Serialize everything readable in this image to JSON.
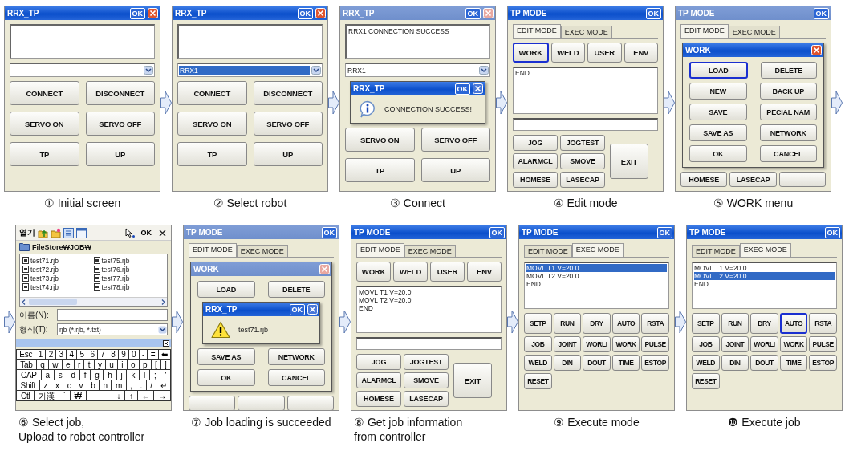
{
  "steps": [
    {
      "caption": [
        "① Initial screen"
      ],
      "window": {
        "kind": "app",
        "title": "RRX_TP",
        "dimmed": false,
        "ok": "OK",
        "close": true,
        "parts": [
          {
            "kind": "log"
          },
          {
            "kind": "combo",
            "selected": false
          },
          {
            "kind": "buttons",
            "rows": [
              [
                {
                  "label": "CONNECT",
                  "selected": false
                },
                {
                  "label": "DISCONNECT",
                  "selected": false
                }
              ],
              [
                {
                  "label": "SERVO ON",
                  "selected": false
                },
                {
                  "label": "SERVO OFF",
                  "selected": false
                }
              ],
              [
                {
                  "label": "TP",
                  "selected": false
                },
                {
                  "label": "UP",
                  "selected": false
                }
              ]
            ]
          }
        ]
      }
    },
    {
      "caption": [
        "② Select robot"
      ],
      "window": {
        "kind": "app",
        "title": "RRX_TP",
        "dimmed": false,
        "ok": "OK",
        "close": true,
        "parts": [
          {
            "kind": "log"
          },
          {
            "kind": "combo",
            "value": "RRX1",
            "selected": true
          },
          {
            "kind": "buttons",
            "rows": [
              [
                {
                  "label": "CONNECT",
                  "selected": false
                },
                {
                  "label": "DISCONNECT",
                  "selected": false
                }
              ],
              [
                {
                  "label": "SERVO ON",
                  "selected": false
                },
                {
                  "label": "SERVO OFF",
                  "selected": false
                }
              ],
              [
                {
                  "label": "TP",
                  "selected": false
                },
                {
                  "label": "UP",
                  "selected": false
                }
              ]
            ]
          }
        ]
      }
    },
    {
      "caption": [
        "③ Connect"
      ],
      "window": {
        "kind": "app",
        "title": "RRX_TP",
        "dimmed": true,
        "ok": "OK",
        "close": true,
        "parts": [
          {
            "kind": "log",
            "text": "RRX1 CONNECTION SUCCESS"
          },
          {
            "kind": "combo",
            "value": "RRX1",
            "selected": false
          },
          {
            "kind": "info_popup",
            "title": "RRX_TP",
            "dimmed": false,
            "ok": "OK",
            "close": true,
            "message": "CONNECTION SUCCESS!"
          },
          {
            "kind": "buttons",
            "rows": [
              [
                {
                  "label": "SERVO ON",
                  "selected": false
                },
                {
                  "label": "SERVO OFF",
                  "selected": false
                }
              ],
              [
                {
                  "label": "TP",
                  "selected": false
                },
                {
                  "label": "UP",
                  "selected": false
                }
              ]
            ]
          }
        ]
      }
    },
    {
      "caption": [
        "④ Edit mode"
      ],
      "window": {
        "kind": "app",
        "title": "TP MODE",
        "dimmed": false,
        "ok": "OK",
        "close": false,
        "parts": [
          {
            "kind": "tabs",
            "tabs": [
              {
                "label": "EDIT MODE",
                "selected": true
              },
              {
                "label": "EXEC MODE",
                "selected": false
              }
            ]
          },
          {
            "kind": "toolbar",
            "rows": [
              [
                {
                  "label": "WORK",
                  "selected": true
                },
                {
                  "label": "WELD",
                  "selected": false
                },
                {
                  "label": "USER",
                  "selected": false
                },
                {
                  "label": "ENV",
                  "selected": false
                }
              ]
            ]
          },
          {
            "kind": "listing",
            "lines": [
              {
                "text": "END",
                "selected": false
              }
            ]
          },
          {
            "kind": "input"
          },
          {
            "kind": "jog",
            "buttons": [
              {
                "label": "JOG",
                "selected": false
              },
              {
                "label": "JOGTEST",
                "selected": false
              },
              {
                "label": "ALARMCL",
                "selected": false
              },
              {
                "label": "SMOVE",
                "selected": false
              },
              {
                "label": "HOMESE",
                "selected": false
              },
              {
                "label": "LASECAP",
                "selected": false
              }
            ],
            "exit": {
              "label": "EXIT",
              "selected": false
            }
          }
        ]
      }
    },
    {
      "caption": [
        "⑤ WORK menu"
      ],
      "window": {
        "kind": "app",
        "title": "TP MODE",
        "dimmed": true,
        "ok": "OK",
        "close": false,
        "parts": [
          {
            "kind": "tabs",
            "tabs": [
              {
                "label": "EDIT MODE",
                "selected": true
              },
              {
                "label": "EXEC MODE",
                "selected": false
              }
            ]
          },
          {
            "kind": "dialog",
            "title": "WORK",
            "dimmed": false,
            "close": true,
            "parts": [
              {
                "kind": "menu_buttons",
                "rows": [
                  [
                    {
                      "label": "LOAD",
                      "selected": true
                    },
                    {
                      "label": "DELETE",
                      "selected": false
                    }
                  ],
                  [
                    {
                      "label": "NEW",
                      "selected": false
                    },
                    {
                      "label": "BACK UP",
                      "selected": false
                    }
                  ],
                  [
                    {
                      "label": "SAVE",
                      "selected": false
                    },
                    {
                      "label": "PECIAL NAM",
                      "selected": false
                    }
                  ],
                  [
                    {
                      "label": "SAVE AS",
                      "selected": false
                    },
                    {
                      "label": "NETWORK",
                      "selected": false
                    }
                  ],
                  [
                    {
                      "label": "OK",
                      "selected": false
                    },
                    {
                      "label": "CANCEL",
                      "selected": false
                    }
                  ]
                ]
              }
            ]
          },
          {
            "kind": "footer_buttons",
            "rows": [
              [
                {
                  "label": "HOMESE",
                  "selected": false
                },
                {
                  "label": "LASECAP",
                  "selected": false
                },
                {
                  "selected": false
                }
              ]
            ]
          }
        ]
      }
    },
    {
      "caption": [
        "⑥ Select job,",
        "Upload to robot controller"
      ],
      "window": {
        "kind": "file",
        "title": "열기",
        "ok": "OK",
        "path": "FileStore₩JOB₩",
        "files": [
          "test71.rjb",
          "test72.rjb",
          "test73.rjb",
          "test74.rjb",
          "test75.rjb",
          "test76.rjb",
          "test77.rjb",
          "test78.rjb"
        ],
        "name_label": "이름(N):",
        "type_label": "형식(T):",
        "type_value": "rjb (*.rjb, *.txt)",
        "keyboard": [
          {
            "keys": [
              "Esc",
              "1",
              "2",
              "3",
              "4",
              "5",
              "6",
              "7",
              "8",
              "9",
              "0",
              "-",
              "=",
              "⬅"
            ]
          },
          {
            "keys": [
              "Tab",
              "q",
              "w",
              "e",
              "r",
              "t",
              "y",
              "u",
              "i",
              "o",
              "p",
              "[",
              "]"
            ]
          },
          {
            "keys": [
              "CAP",
              "a",
              "s",
              "d",
              "f",
              "g",
              "h",
              "j",
              "k",
              "l",
              ";",
              "'"
            ]
          },
          {
            "keys": [
              "Shift",
              "z",
              "x",
              "c",
              "v",
              "b",
              "n",
              "m",
              ",",
              ".",
              "/",
              "↵"
            ]
          },
          {
            "keys": [
              "Ctl",
              "가漢",
              "`",
              "₩"
            ],
            "tail": [
              "↓",
              "↑",
              "←",
              "→"
            ]
          }
        ]
      }
    },
    {
      "caption": [
        "⑦ Job loading is succeeded"
      ],
      "window": {
        "kind": "app",
        "title": "TP MODE",
        "dimmed": true,
        "ok": "OK",
        "close": false,
        "parts": [
          {
            "kind": "tabs",
            "tabs": [
              {
                "label": "EDIT MODE",
                "selected": true
              },
              {
                "label": "EXEC MODE",
                "selected": false
              }
            ]
          },
          {
            "kind": "dialog",
            "title": "WORK",
            "dimmed": true,
            "close": true,
            "parts": [
              {
                "kind": "menu_buttons",
                "rows": [
                  [
                    {
                      "label": "LOAD",
                      "selected": false
                    },
                    {
                      "label": "DELETE",
                      "selected": false
                    }
                  ]
                ]
              },
              {
                "kind": "warning_popup",
                "title": "RRX_TP",
                "dimmed": false,
                "ok": "OK",
                "close": true,
                "message": "test71.rjb"
              },
              {
                "kind": "menu_buttons",
                "rows": [
                  [
                    {
                      "label": "SAVE AS",
                      "selected": false
                    },
                    {
                      "label": "NETWORK",
                      "selected": false
                    }
                  ],
                  [
                    {
                      "label": "OK",
                      "selected": false
                    },
                    {
                      "label": "CANCEL",
                      "selected": false
                    }
                  ]
                ]
              }
            ]
          },
          {
            "kind": "footer_buttons",
            "rows": [
              [
                {
                  "selected": false
                },
                {
                  "selected": false
                },
                {
                  "selected": false
                }
              ]
            ]
          }
        ]
      }
    },
    {
      "caption": [
        "⑧ Get job information",
        "from controller"
      ],
      "window": {
        "kind": "app",
        "title": "TP MODE",
        "dimmed": false,
        "ok": "OK",
        "close": false,
        "parts": [
          {
            "kind": "tabs",
            "tabs": [
              {
                "label": "EDIT MODE",
                "selected": true
              },
              {
                "label": "EXEC MODE",
                "selected": false
              }
            ]
          },
          {
            "kind": "toolbar",
            "rows": [
              [
                {
                  "label": "WORK",
                  "selected": false
                },
                {
                  "label": "WELD",
                  "selected": false
                },
                {
                  "label": "USER",
                  "selected": false
                },
                {
                  "label": "ENV",
                  "selected": false
                }
              ]
            ]
          },
          {
            "kind": "listing",
            "lines": [
              {
                "text": "MOVL T1 V=20.0",
                "selected": false
              },
              {
                "text": "MOVL T2 V=20.0",
                "selected": false
              },
              {
                "text": "END",
                "selected": false
              }
            ]
          },
          {
            "kind": "input"
          },
          {
            "kind": "jog",
            "buttons": [
              {
                "label": "JOG",
                "selected": false
              },
              {
                "label": "JOGTEST",
                "selected": false
              },
              {
                "label": "ALARMCL",
                "selected": false
              },
              {
                "label": "SMOVE",
                "selected": false
              },
              {
                "label": "HOMESE",
                "selected": false
              },
              {
                "label": "LASECAP",
                "selected": false
              }
            ],
            "exit": {
              "label": "EXIT",
              "selected": false
            }
          }
        ]
      }
    },
    {
      "caption": [
        "⑨ Execute mode"
      ],
      "window": {
        "kind": "app",
        "title": "TP MODE",
        "dimmed": false,
        "ok": "OK",
        "close": false,
        "parts": [
          {
            "kind": "tabs",
            "tabs": [
              {
                "label": "EDIT MODE",
                "selected": false
              },
              {
                "label": "EXEC MODE",
                "selected": true
              }
            ]
          },
          {
            "kind": "listing",
            "lines": [
              {
                "text": "MOVL T1 V=20.0",
                "selected": true
              },
              {
                "text": "MOVL T2 V=20.0",
                "selected": false
              },
              {
                "text": "END",
                "selected": false
              }
            ]
          },
          {
            "kind": "exec",
            "rows": [
              [
                {
                  "label": "SETP",
                  "selected": false
                },
                {
                  "label": "RUN",
                  "selected": false
                },
                {
                  "label": "DRY",
                  "selected": false
                },
                {
                  "label": "AUTO",
                  "selected": false
                },
                {
                  "label": "RSTA",
                  "selected": false
                }
              ],
              [
                {
                  "label": "JOB",
                  "selected": false
                },
                {
                  "label": "JOINT",
                  "selected": false
                },
                {
                  "label": "WORLI",
                  "selected": false
                },
                {
                  "label": "WORK",
                  "selected": false
                },
                {
                  "label": "PULSE",
                  "selected": false
                }
              ],
              [
                {
                  "label": "WELD",
                  "selected": false
                },
                {
                  "label": "DIN",
                  "selected": false
                },
                {
                  "label": "DOUT",
                  "selected": false
                },
                {
                  "label": "TIME",
                  "selected": false
                }
              ],
              [
                {
                  "label": "RESET",
                  "selected": false
                }
              ]
            ],
            "estop": {
              "label": "ESTOP",
              "selected": false
            }
          }
        ]
      }
    },
    {
      "caption": [
        "❿ Execute job"
      ],
      "window": {
        "kind": "app",
        "title": "TP MODE",
        "dimmed": false,
        "ok": "OK",
        "close": false,
        "parts": [
          {
            "kind": "tabs",
            "tabs": [
              {
                "label": "EDIT MODE",
                "selected": false
              },
              {
                "label": "EXEC MODE",
                "selected": true
              }
            ]
          },
          {
            "kind": "listing",
            "lines": [
              {
                "text": "MOVL T1 V=20.0",
                "selected": false
              },
              {
                "text": "MOVL T2 V=20.0",
                "selected": true
              },
              {
                "text": "END",
                "selected": false
              }
            ]
          },
          {
            "kind": "exec",
            "rows": [
              [
                {
                  "label": "SETP",
                  "selected": false
                },
                {
                  "label": "RUN",
                  "selected": false
                },
                {
                  "label": "DRY",
                  "selected": false
                },
                {
                  "label": "AUTO",
                  "selected": true
                },
                {
                  "label": "RSTA",
                  "selected": false
                }
              ],
              [
                {
                  "label": "JOB",
                  "selected": false
                },
                {
                  "label": "JOINT",
                  "selected": false
                },
                {
                  "label": "WORLI",
                  "selected": false
                },
                {
                  "label": "WORK",
                  "selected": false
                },
                {
                  "label": "PULSE",
                  "selected": false
                }
              ],
              [
                {
                  "label": "WELD",
                  "selected": false
                },
                {
                  "label": "DIN",
                  "selected": false
                },
                {
                  "label": "DOUT",
                  "selected": false
                },
                {
                  "label": "TIME",
                  "selected": false
                }
              ],
              [
                {
                  "label": "RESET",
                  "selected": false
                }
              ]
            ],
            "estop": {
              "label": "ESTOP",
              "selected": false
            }
          }
        ]
      }
    }
  ]
}
